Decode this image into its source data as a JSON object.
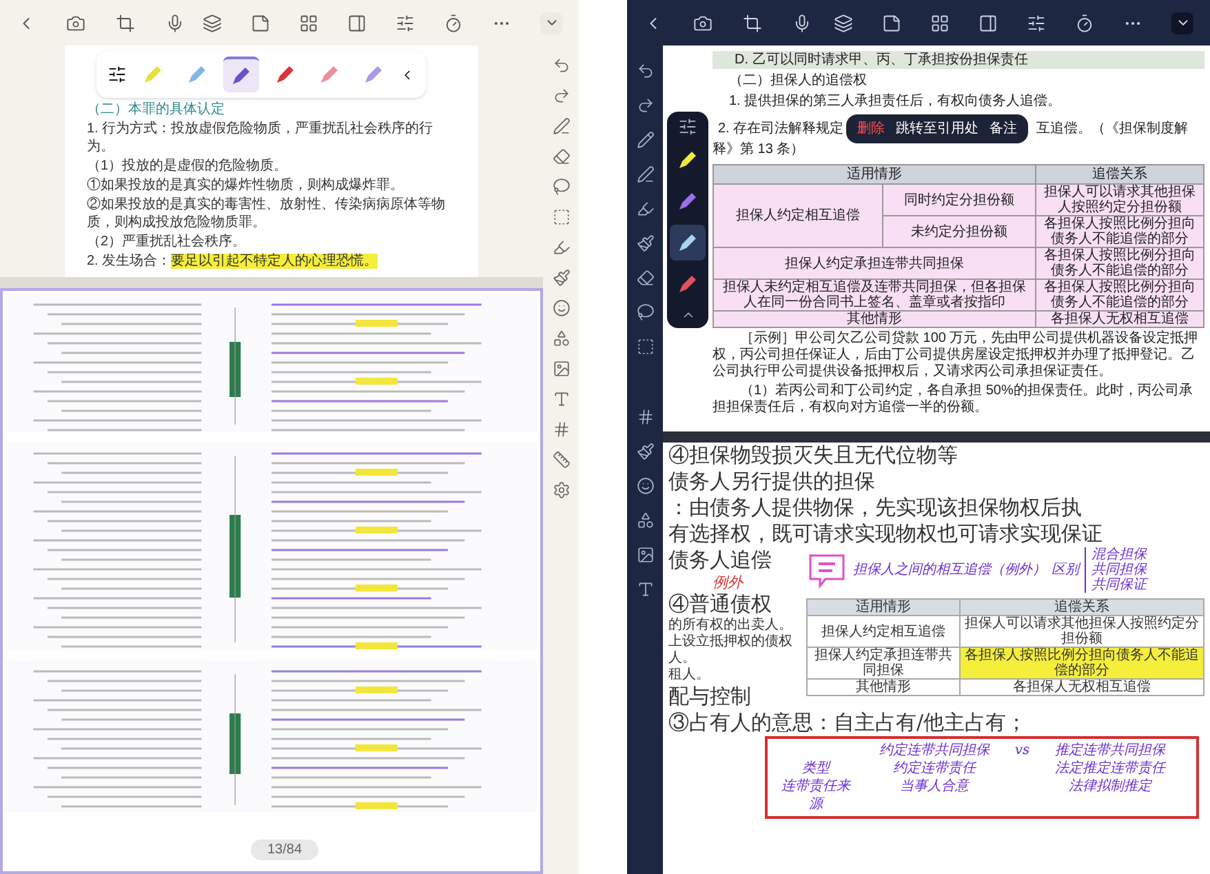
{
  "left_screen": {
    "pen_palette": {
      "pens": [
        {
          "color": "#e6e03a",
          "selected": false
        },
        {
          "color": "#7fb6e8",
          "selected": false
        },
        {
          "color": "#6a4fd0",
          "selected": true
        },
        {
          "color": "#d9343b",
          "selected": false
        },
        {
          "color": "#eb8f9a",
          "selected": false
        },
        {
          "color": "#a99be8",
          "selected": false
        }
      ]
    },
    "document": {
      "paragraphs": [
        {
          "kind": "heading",
          "segments": [
            {
              "text": "（二）本罪的具体认定",
              "highlight": false
            }
          ]
        },
        {
          "kind": "body",
          "segments": [
            {
              "text": "1. 行为方式：投放虚假危险物质，严重扰乱社会秩序的行为。",
              "highlight": false
            }
          ]
        },
        {
          "kind": "body",
          "segments": [
            {
              "text": "（1）投放的是虚假的危险物质。",
              "highlight": false
            }
          ]
        },
        {
          "kind": "body",
          "segments": [
            {
              "text": "①如果投放的是真实的爆炸性物质，则构成爆炸罪。",
              "highlight": false
            }
          ]
        },
        {
          "kind": "body",
          "segments": [
            {
              "text": "②如果投放的是真实的毒害性、放射性、传染病病原体等物质，则构成投放危险物质罪。",
              "highlight": false
            }
          ]
        },
        {
          "kind": "body",
          "segments": [
            {
              "text": "（2）严重扰乱社会秩序。",
              "highlight": false
            }
          ]
        },
        {
          "kind": "body",
          "segments": [
            {
              "text": "2. 发生场合：",
              "highlight": false
            },
            {
              "text": "要足以引起不特定人的心理恐慌。",
              "highlight": true
            }
          ]
        }
      ]
    },
    "page_counter": "13/84"
  },
  "right_screen": {
    "pen_palette": {
      "pens": [
        {
          "color": "#f2ea3c",
          "selected": false
        },
        {
          "color": "#9b6ee8",
          "selected": false
        },
        {
          "color": "#a9d4f2",
          "selected": true
        },
        {
          "color": "#e0525a",
          "selected": false
        }
      ]
    },
    "document": {
      "banner": "D. 乙可以同时请求甲、丙、丁承担按份担保责任",
      "heading": "（二）担保人的追偿权",
      "line_1": "1. 提供担保的第三人承担责任后，有权向债务人追偿。",
      "line_2_start": "2. 存在司法解释规定",
      "line_2_end": "互追偿。（《担保制度解",
      "line_3": "释》第 13 条）",
      "context_menu": [
        {
          "label": "删除",
          "kind": "danger"
        },
        {
          "label": "跳转至引用处",
          "kind": "normal"
        },
        {
          "label": "备注",
          "kind": "normal"
        }
      ],
      "table": {
        "columns": [
          {
            "label": "适用情形",
            "colspan": 2
          },
          {
            "label": "追偿关系"
          }
        ],
        "rows": [
          [
            {
              "text": "担保人约定相互追偿",
              "rowspan": 2
            },
            {
              "text": "同时约定分担份额"
            },
            {
              "text": "担保人可以请求其他担保人按照约定分担份额"
            }
          ],
          [
            {
              "text": "未约定分担份额"
            },
            {
              "text": "各担保人按照比例分担向债务人不能追偿的部分"
            }
          ],
          [
            {
              "text": "担保人约定承担连带共同担保",
              "colspan": 2
            },
            {
              "text": "各担保人按照比例分担向债务人不能追偿的部分"
            }
          ],
          [
            {
              "text": "担保人未约定相互追偿及连带共同担保，但各担保人在同一份合同书上签名、盖章或者按指印",
              "colspan": 2
            },
            {
              "text": "各担保人按照比例分担向债务人不能追偿的部分"
            }
          ],
          [
            {
              "text": "其他情形",
              "colspan": 2
            },
            {
              "text": "各担保人无权相互追偿"
            }
          ]
        ]
      },
      "example": "［示例］甲公司欠乙公司贷款 100 万元，先由甲公司提供机器设备设定抵押权，丙公司担任保证人，后由丁公司提供房屋设定抵押权并办理了抵押登记。乙公司执行甲公司提供设备抵押权后，又请求丙公司承担保证责任。",
      "example_1": "（1）若丙公司和丁公司约定，各自承担 50%的担保责任。此时，丙公司承担担保责任后，有权向对方追偿一半的份额。"
    },
    "notes": {
      "lines_top": [
        "④担保物毁损灭失且无代位物等",
        "债务人另行提供的担保",
        "：由债务人提供物保，先实现该担保物权后执",
        "有选择权，既可请求实现物权也可请求实现保证"
      ],
      "debtor_recourse": "债务人追偿",
      "handwritten_exception": "例外",
      "general_claim": "④普通债权",
      "small_lines": [
        "的所有权的出卖人。",
        "上设立抵押权的债权人。",
        "租人。"
      ],
      "distribution": "配与控制",
      "handwritten_title": "担保人之间的相互追偿（例外）",
      "handwritten_distinction": "区别",
      "handwritten_list": [
        "混合担保",
        "共同担保",
        "共同保证"
      ],
      "table": {
        "columns": [
          "适用情形",
          "追偿关系"
        ],
        "rows": [
          [
            {
              "text": "担保人约定相互追偿",
              "highlight": false
            },
            {
              "text": "担保人可以请求其他担保人按照约定分担份额",
              "highlight": false
            }
          ],
          [
            {
              "text": "担保人约定承担连带共同担保",
              "highlight": false
            },
            {
              "text": "各担保人按照比例分担向债务人不能追偿的部分",
              "highlight": true
            }
          ],
          [
            {
              "text": "其他情形",
              "highlight": false
            },
            {
              "text": "各担保人无权相互追偿",
              "highlight": false
            }
          ]
        ]
      },
      "possession": "③占有人的意思：自主占有/他主占有；",
      "comparison": {
        "headers": [
          "约定连带共同担保",
          "vs",
          "推定连带共同担保"
        ],
        "rows": [
          {
            "label": "类型",
            "left": "约定连带责任",
            "right": "法定推定连带责任"
          },
          {
            "label": "连带责任来源",
            "left": "当事人合意",
            "right": "法律拟制推定"
          }
        ]
      }
    }
  }
}
